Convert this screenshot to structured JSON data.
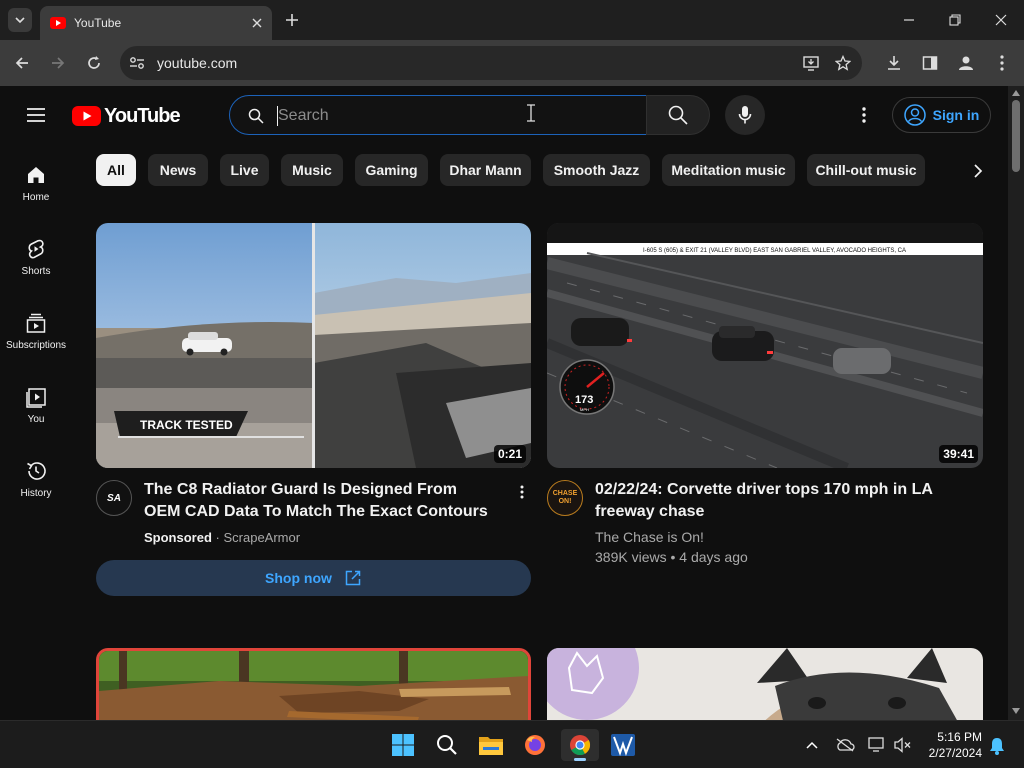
{
  "browser": {
    "tab_title": "YouTube",
    "url": "youtube.com",
    "icons": [
      "tab-search-icon",
      "youtube-favicon",
      "tab-close-icon",
      "new-tab-icon",
      "minimize-icon",
      "maximize-icon",
      "window-close-icon",
      "back-icon",
      "forward-icon",
      "reload-icon",
      "site-info-icon",
      "install-app-icon",
      "bookmark-star-icon",
      "download-icon",
      "side-panel-icon",
      "profile-icon",
      "browser-menu-icon"
    ]
  },
  "header": {
    "logo_text": "YouTube",
    "search_placeholder": "Search",
    "signin_label": "Sign in"
  },
  "chips": [
    "All",
    "News",
    "Live",
    "Music",
    "Gaming",
    "Dhar Mann",
    "Smooth Jazz",
    "Meditation music",
    "Chill-out music"
  ],
  "sidebar": [
    {
      "label": "Home",
      "icon": "home-icon"
    },
    {
      "label": "Shorts",
      "icon": "shorts-icon"
    },
    {
      "label": "Subscriptions",
      "icon": "subscriptions-icon"
    },
    {
      "label": "You",
      "icon": "you-icon"
    },
    {
      "label": "History",
      "icon": "history-icon"
    }
  ],
  "videos": [
    {
      "title": "The C8 Radiator Guard Is Designed From OEM CAD Data To Match The Exact Contours",
      "duration": "0:21",
      "sponsored": "Sponsored",
      "channel": "ScrapeArmor",
      "thumb_text": "TRACK TESTED",
      "avatar_text": "SA",
      "cta": "Shop now"
    },
    {
      "title": "02/22/24: Corvette driver tops 170 mph in LA freeway chase",
      "duration": "39:41",
      "channel": "The Chase is On!",
      "views": "389K views",
      "age": "4 days ago",
      "thumb_banner": "I-605 S (605) & EXIT 21 (VALLEY BLVD)  EAST SAN GABRIEL VALLEY, AVOCADO HEIGHTS, CA",
      "speed_value": "173",
      "speed_unit": "MPH",
      "avatar_text": "CHASE ON!"
    }
  ],
  "taskbar": {
    "time": "5:16 PM",
    "date": "2/27/2024",
    "apps": [
      "windows-start-icon",
      "search-icon",
      "file-explorer-icon",
      "firefox-icon",
      "chrome-icon",
      "app-icon"
    ]
  },
  "colors": {
    "accent": "#3ea6ff",
    "brand": "#ff0000",
    "background": "#0f0f0f"
  }
}
